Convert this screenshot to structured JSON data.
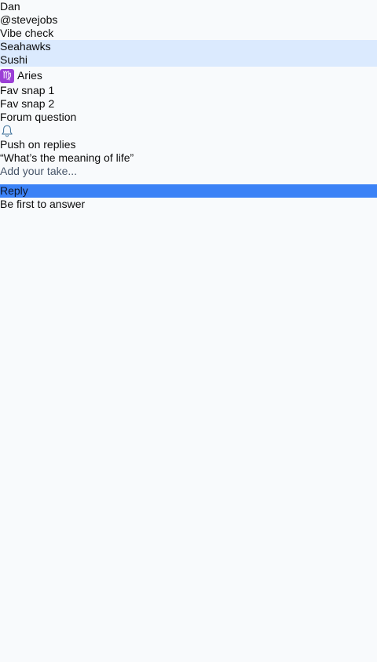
{
  "profile": {
    "name": "Dan",
    "handle": "@stevejobs",
    "vibe_label": "Vibe check",
    "tags": [
      "Seahawks",
      "Sushi"
    ],
    "sign_glyph": "♍",
    "sign_label": "Aries",
    "snaps": [
      "Fav snap 1",
      "Fav snap 2"
    ]
  },
  "forum": {
    "section_label": "Forum question",
    "bell_icon": "bell-icon",
    "push_label": "Push on replies",
    "question": "“What’s the meaning of life”",
    "input_placeholder": "Add your take...",
    "reply_label": "Reply",
    "empty_state": "Be first to answer"
  },
  "colors": {
    "background": "#f8fafc",
    "tag_highlight": "#dbeafe",
    "reply_button": "#3b82f6",
    "sign_badge": "#9b3fd6"
  }
}
